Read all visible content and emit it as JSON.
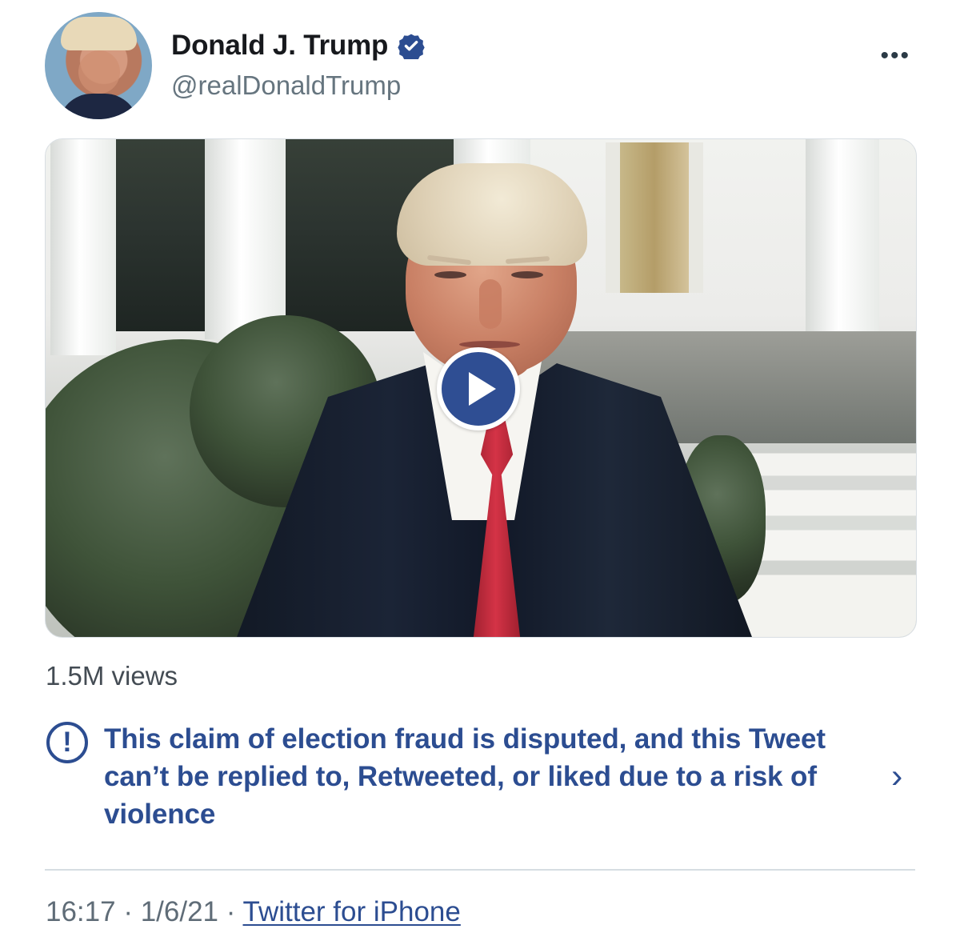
{
  "author": {
    "name": "Donald J. Trump",
    "handle": "@realDonaldTrump",
    "verified_icon": "verified-badge-icon"
  },
  "header": {
    "more_icon": "more-options-icon",
    "more_label": "•••"
  },
  "media": {
    "type": "video",
    "play_icon": "play-icon"
  },
  "stats": {
    "views": "1.5M views"
  },
  "notice": {
    "icon": "exclamation-icon",
    "icon_text": "!",
    "text": "This claim of election fraud is disputed, and this Tweet can’t be replied to, Retweeted, or liked due to a risk of violence",
    "chevron_icon": "chevron-right-icon",
    "chevron_label": "›"
  },
  "footer": {
    "time": "16:17",
    "separator_1": " · ",
    "date": "1/6/21",
    "separator_2": " · ",
    "source": "Twitter for iPhone"
  },
  "colors": {
    "text": "#17191d",
    "muted": "#66757f",
    "link": "#2c4d91",
    "divider": "#d6dde2"
  }
}
